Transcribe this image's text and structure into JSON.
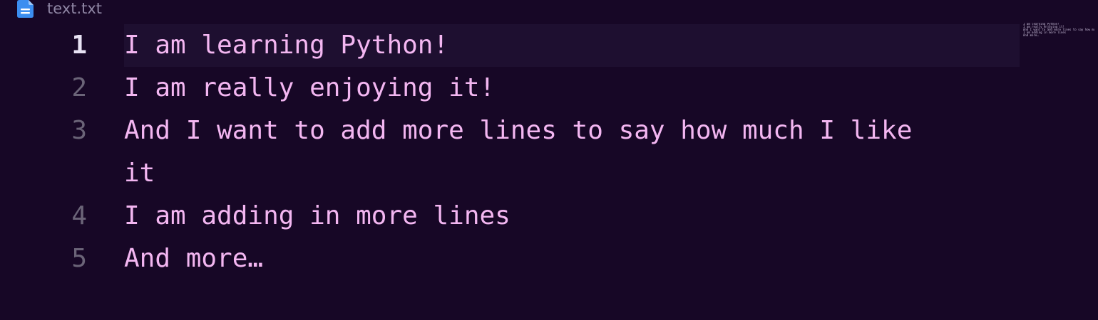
{
  "tab": {
    "title": "text.txt",
    "icon": "file-text-icon",
    "icon_color": "#3b8ef0"
  },
  "editor": {
    "current_line": 1,
    "lines": [
      {
        "number": "1",
        "text": "I am learning Python!"
      },
      {
        "number": "2",
        "text": "I am really enjoying it!"
      },
      {
        "number": "3",
        "text": "And I want to add more lines to say how much I like it"
      },
      {
        "number": "4",
        "text": "I am adding in more lines"
      },
      {
        "number": "5",
        "text": "And more…"
      }
    ]
  },
  "colors": {
    "background": "#170726",
    "text": "#f3b6f1",
    "line_number": "#6b6478",
    "active_line_number": "#e8e2f4",
    "current_line_highlight": "#1e0f30"
  }
}
